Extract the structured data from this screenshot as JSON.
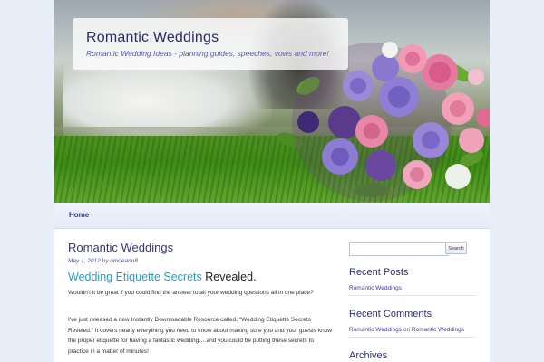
{
  "header": {
    "site_title": "Romantic Weddings",
    "site_description": "Romantic Wedding Ideas - planning guides, speeches, vows and more!"
  },
  "nav": {
    "items": [
      {
        "label": "Home"
      }
    ]
  },
  "post": {
    "title": "Romantic Weddings",
    "date": "May 1, 2012",
    "by_text": "by",
    "author": "omoeann8",
    "subheading_link": "Wedding Etiquette Secrets",
    "subheading_rest": " Revealed.",
    "paragraphs": [
      "Wouldn't it be great if you could find the answer to all your wedding questions all in one place?",
      "I've just released a new Instantly Downloadable Resource called, \"Wedding Etiquette Secrets Reveled.\" It covers nearly everything you need to know about making sure you and your guests know the proper etiquette for having a fantastic wedding… and you could be putting these secrets to practice in a matter of minutes!"
    ]
  },
  "sidebar": {
    "search": {
      "placeholder": "",
      "button_label": "Search"
    },
    "recent_posts": {
      "title": "Recent Posts",
      "items": [
        "Romantic Weddings"
      ]
    },
    "recent_comments": {
      "title": "Recent Comments",
      "author": "Romantic Weddings",
      "on_text": "on",
      "post": "Romantic Weddings"
    },
    "archives": {
      "title": "Archives"
    }
  },
  "colors": {
    "background": "#e8eef8",
    "title": "#2b2b6b",
    "link": "#3b3ba0",
    "accent_link": "#1ea2c8"
  }
}
